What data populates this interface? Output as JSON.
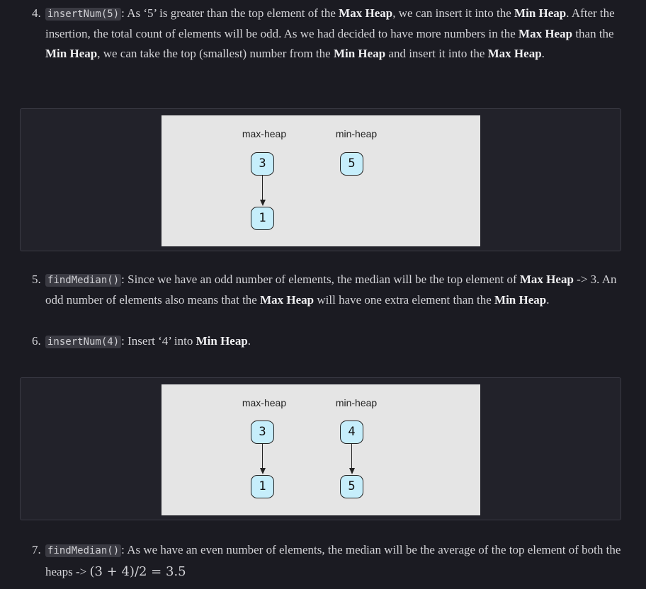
{
  "step4": {
    "num": "4.",
    "code": "insertNum(5)",
    "t1": ": As ‘5’ is greater than the top element of the ",
    "b1": "Max Heap",
    "t2": ", we can insert it into the ",
    "b2": "Min Heap",
    "t3": ". After the insertion, the total count of elements will be odd. As we had decided to have more numbers in the ",
    "b3": "Max Heap",
    "t4": " than the ",
    "b4": "Min Heap",
    "t5": ", we can take the top (smallest) number from the ",
    "b5": "Min Heap",
    "t6": " and insert it into the ",
    "b6": "Max Heap",
    "t7": "."
  },
  "diagram1": {
    "max_label": "max-heap",
    "min_label": "min-heap",
    "max_nodes": [
      "3",
      "1"
    ],
    "min_nodes": [
      "5"
    ]
  },
  "step5": {
    "num": "5.",
    "code": "findMedian()",
    "t1": ": Since we have an odd number of elements, the median will be the top element of ",
    "b1": "Max Heap",
    "t2": " -> 3. An odd number of elements also means that the ",
    "b2": "Max Heap",
    "t3": " will have one extra element than the ",
    "b3": "Min Heap",
    "t4": "."
  },
  "step6": {
    "num": "6.",
    "code": "insertNum(4)",
    "t1": ": Insert ‘4’ into ",
    "b1": "Min Heap",
    "t2": "."
  },
  "diagram2": {
    "max_label": "max-heap",
    "min_label": "min-heap",
    "max_nodes": [
      "3",
      "1"
    ],
    "min_nodes": [
      "4",
      "5"
    ]
  },
  "step7": {
    "num": "7.",
    "code": "findMedian()",
    "t1": ": As we have an even number of elements, the median will be the average of the top element of both the heaps -> ",
    "math": "(3 + 4)/2 = 3.5"
  }
}
